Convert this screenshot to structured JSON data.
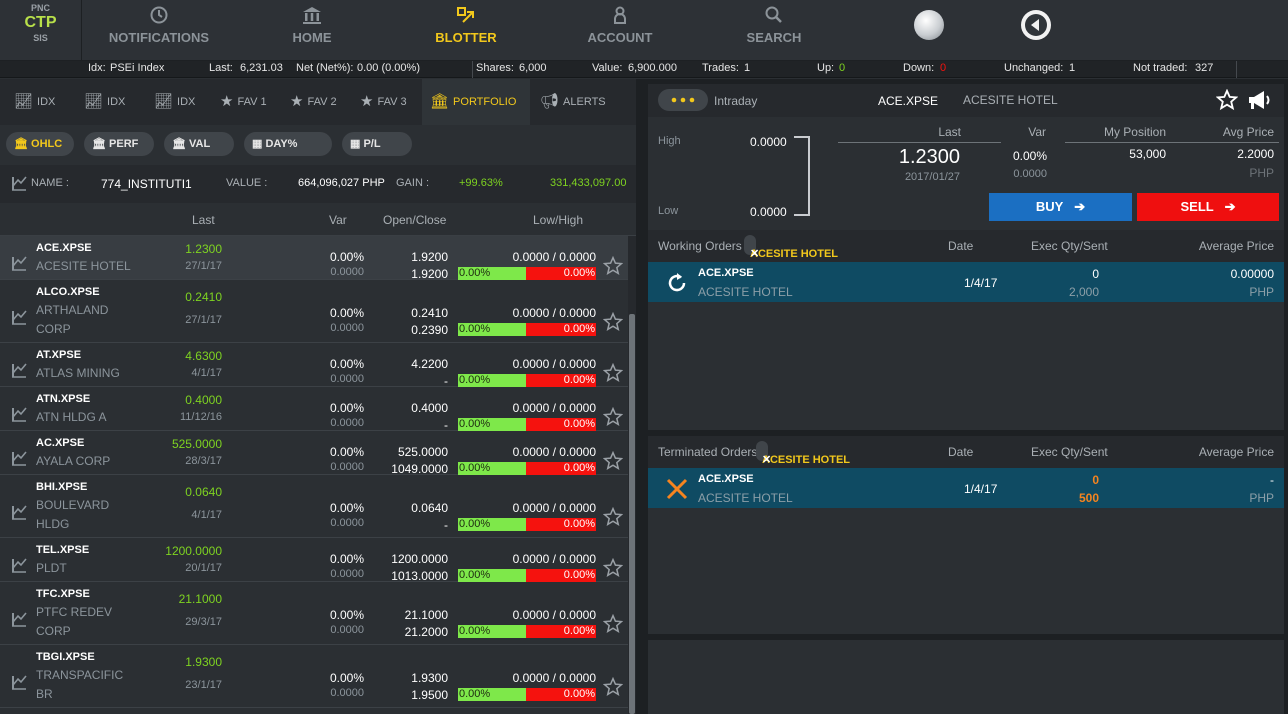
{
  "logo": {
    "top": "PNC",
    "main": "CTP",
    "bottom": "SIS"
  },
  "nav": [
    {
      "label": "NOTIFICATIONS",
      "icon": "clock-icon"
    },
    {
      "label": "HOME",
      "icon": "bank-icon"
    },
    {
      "label": "BLOTTER",
      "icon": "blotter-icon",
      "active": true
    },
    {
      "label": "ACCOUNT",
      "icon": "user-icon"
    },
    {
      "label": "SEARCH",
      "icon": "search-icon"
    }
  ],
  "stats": {
    "idx_label": "Idx:",
    "idx_value": "PSEi Index",
    "last_label": "Last:",
    "last_value": "6,231.03",
    "net_label": "Net (Net%):",
    "net_value": "0.00 (0.00%)",
    "shares_label": "Shares:",
    "shares_value": "6,000",
    "value_label": "Value:",
    "value_value": "6,900.000",
    "trades_label": "Trades:",
    "trades_value": "1",
    "up_label": "Up:",
    "up_value": "0",
    "down_label": "Down:",
    "down_value": "0",
    "unch_label": "Unchanged:",
    "unch_value": "1",
    "nt_label": "Not traded:",
    "nt_value": "327"
  },
  "tabs": [
    {
      "label": "IDX"
    },
    {
      "label": "IDX"
    },
    {
      "label": "IDX"
    },
    {
      "label": "FAV 1"
    },
    {
      "label": "FAV 2"
    },
    {
      "label": "FAV 3"
    },
    {
      "label": "PORTFOLIO",
      "active": true
    },
    {
      "label": "ALERTS"
    }
  ],
  "subtabs": [
    "OHLC",
    "PERF",
    "VAL",
    "DAY%",
    "P/L"
  ],
  "account": {
    "name_label": "NAME :",
    "name": "774_INSTITUTI1",
    "value_label": "VALUE :",
    "value": "664,096,027 PHP",
    "gain_label": "GAIN :",
    "gain_pct": "+99.63%",
    "gain_amt": "331,433,097.00"
  },
  "columns": {
    "last": "Last",
    "var": "Var",
    "oc": "Open/Close",
    "lh": "Low/High"
  },
  "rows": [
    {
      "sym": "ACE.XPSE",
      "name": "ACESITE HOTEL",
      "last": "1.2300",
      "date": "27/1/17",
      "var": "0.00%",
      "var2": "0.0000",
      "open": "1.9200",
      "close": "1.9200",
      "lh": "0.0000 / 0.0000",
      "g": "0.00%",
      "r": "0.00%"
    },
    {
      "sym": "ALCO.XPSE",
      "name": "ARTHALAND CORP",
      "last": "0.2410",
      "date": "27/1/17",
      "var": "0.00%",
      "var2": "0.0000",
      "open": "0.2410",
      "close": "0.2390",
      "lh": "0.0000 / 0.0000",
      "g": "0.00%",
      "r": "0.00%"
    },
    {
      "sym": "AT.XPSE",
      "name": "ATLAS MINING",
      "last": "4.6300",
      "date": "4/1/17",
      "var": "0.00%",
      "var2": "0.0000",
      "open": "4.2200",
      "close": "-",
      "lh": "0.0000 / 0.0000",
      "g": "0.00%",
      "r": "0.00%"
    },
    {
      "sym": "ATN.XPSE",
      "name": "ATN HLDG A",
      "last": "0.4000",
      "date": "11/12/16",
      "var": "0.00%",
      "var2": "0.0000",
      "open": "0.4000",
      "close": "-",
      "lh": "0.0000 / 0.0000",
      "g": "0.00%",
      "r": "0.00%"
    },
    {
      "sym": "AC.XPSE",
      "name": "AYALA CORP",
      "last": "525.0000",
      "date": "28/3/17",
      "var": "0.00%",
      "var2": "0.0000",
      "open": "525.0000",
      "close": "1049.0000",
      "lh": "0.0000 / 0.0000",
      "g": "0.00%",
      "r": "0.00%"
    },
    {
      "sym": "BHI.XPSE",
      "name": "BOULEVARD HLDG",
      "last": "0.0640",
      "date": "4/1/17",
      "var": "0.00%",
      "var2": "0.0000",
      "open": "0.0640",
      "close": "-",
      "lh": "0.0000 / 0.0000",
      "g": "0.00%",
      "r": "0.00%"
    },
    {
      "sym": "TEL.XPSE",
      "name": "PLDT",
      "last": "1200.0000",
      "date": "20/1/17",
      "var": "0.00%",
      "var2": "0.0000",
      "open": "1200.0000",
      "close": "1013.0000",
      "lh": "0.0000 / 0.0000",
      "g": "0.00%",
      "r": "0.00%"
    },
    {
      "sym": "TFC.XPSE",
      "name": "PTFC REDEV CORP",
      "last": "21.1000",
      "date": "29/3/17",
      "var": "0.00%",
      "var2": "0.0000",
      "open": "21.1000",
      "close": "21.2000",
      "lh": "0.0000 / 0.0000",
      "g": "0.00%",
      "r": "0.00%"
    },
    {
      "sym": "TBGI.XPSE",
      "name": "TRANSPACIFIC BR",
      "last": "1.9300",
      "date": "23/1/17",
      "var": "0.00%",
      "var2": "0.0000",
      "open": "1.9300",
      "close": "1.9500",
      "lh": "0.0000 / 0.0000",
      "g": "0.00%",
      "r": "0.00%"
    }
  ],
  "detail": {
    "intraday": "Intraday",
    "sym": "ACE.XPSE",
    "name": "ACESITE HOTEL",
    "high_label": "High",
    "high": "0.0000",
    "low_label": "Low",
    "low": "0.0000",
    "last_label": "Last",
    "last": "1.2300",
    "date": "2017/01/27",
    "var_label": "Var",
    "var": "0.00%",
    "var2": "0.0000",
    "pos_label": "My Position",
    "pos": "53,000",
    "avg_label": "Avg Price",
    "avg": "2.2000",
    "ccy": "PHP",
    "buy": "BUY",
    "sell": "SELL"
  },
  "working": {
    "title": "Working Orders",
    "chip": "ACESITE HOTEL",
    "date_h": "Date",
    "exec_h": "Exec Qty/Sent",
    "avg_h": "Average Price",
    "sym": "ACE.XPSE",
    "name": "ACESITE HOTEL",
    "date": "1/4/17",
    "exec": "0",
    "sent": "2,000",
    "avg": "0.00000",
    "ccy": "PHP"
  },
  "terminated": {
    "title": "Terminated Orders",
    "chip": "ACESITE HOTEL",
    "date_h": "Date",
    "exec_h": "Exec Qty/Sent",
    "avg_h": "Average Price",
    "sym": "ACE.XPSE",
    "name": "ACESITE HOTEL",
    "date": "1/4/17",
    "exec": "0",
    "sent": "500",
    "avg": "-",
    "ccy": "PHP"
  },
  "colors": {
    "accent": "#f2c81c",
    "green": "#7ed321",
    "red": "#f5120e",
    "buy": "#1b6fc2",
    "sell": "#ef0f0f",
    "order_row": "#0f4b63"
  }
}
